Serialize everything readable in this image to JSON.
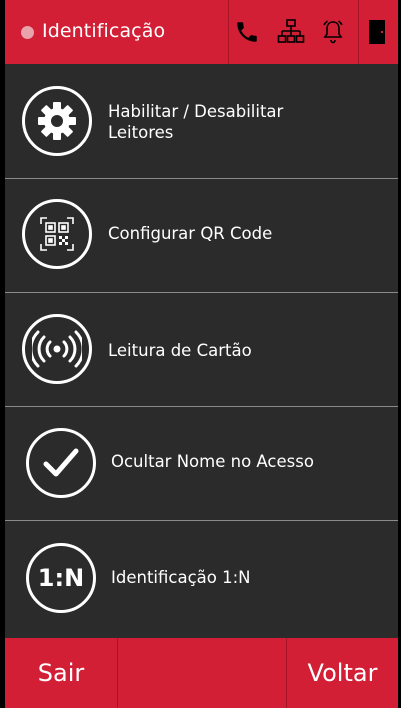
{
  "header": {
    "title": "Identificação",
    "icons": [
      "phone-icon",
      "network-icon",
      "bell-icon",
      "door-icon"
    ]
  },
  "menu": {
    "items": [
      {
        "label_line1": "Habilitar / Desabilitar",
        "label_line2": "Leitores",
        "icon": "gear-icon"
      },
      {
        "label": "Configurar QR Code",
        "icon": "qr-code-icon"
      },
      {
        "label": "Leitura de Cartão",
        "icon": "rfid-icon"
      },
      {
        "label": "Ocultar Nome no Acesso",
        "icon": "check-icon"
      },
      {
        "label": "Identificação 1:N",
        "icon": "one-to-n-icon",
        "icon_text": "1:N"
      }
    ]
  },
  "footer": {
    "exit_label": "Sair",
    "back_label": "Voltar"
  },
  "colors": {
    "brand_red": "#d21f35",
    "background": "#2b2b2b",
    "text": "#ffffff"
  }
}
